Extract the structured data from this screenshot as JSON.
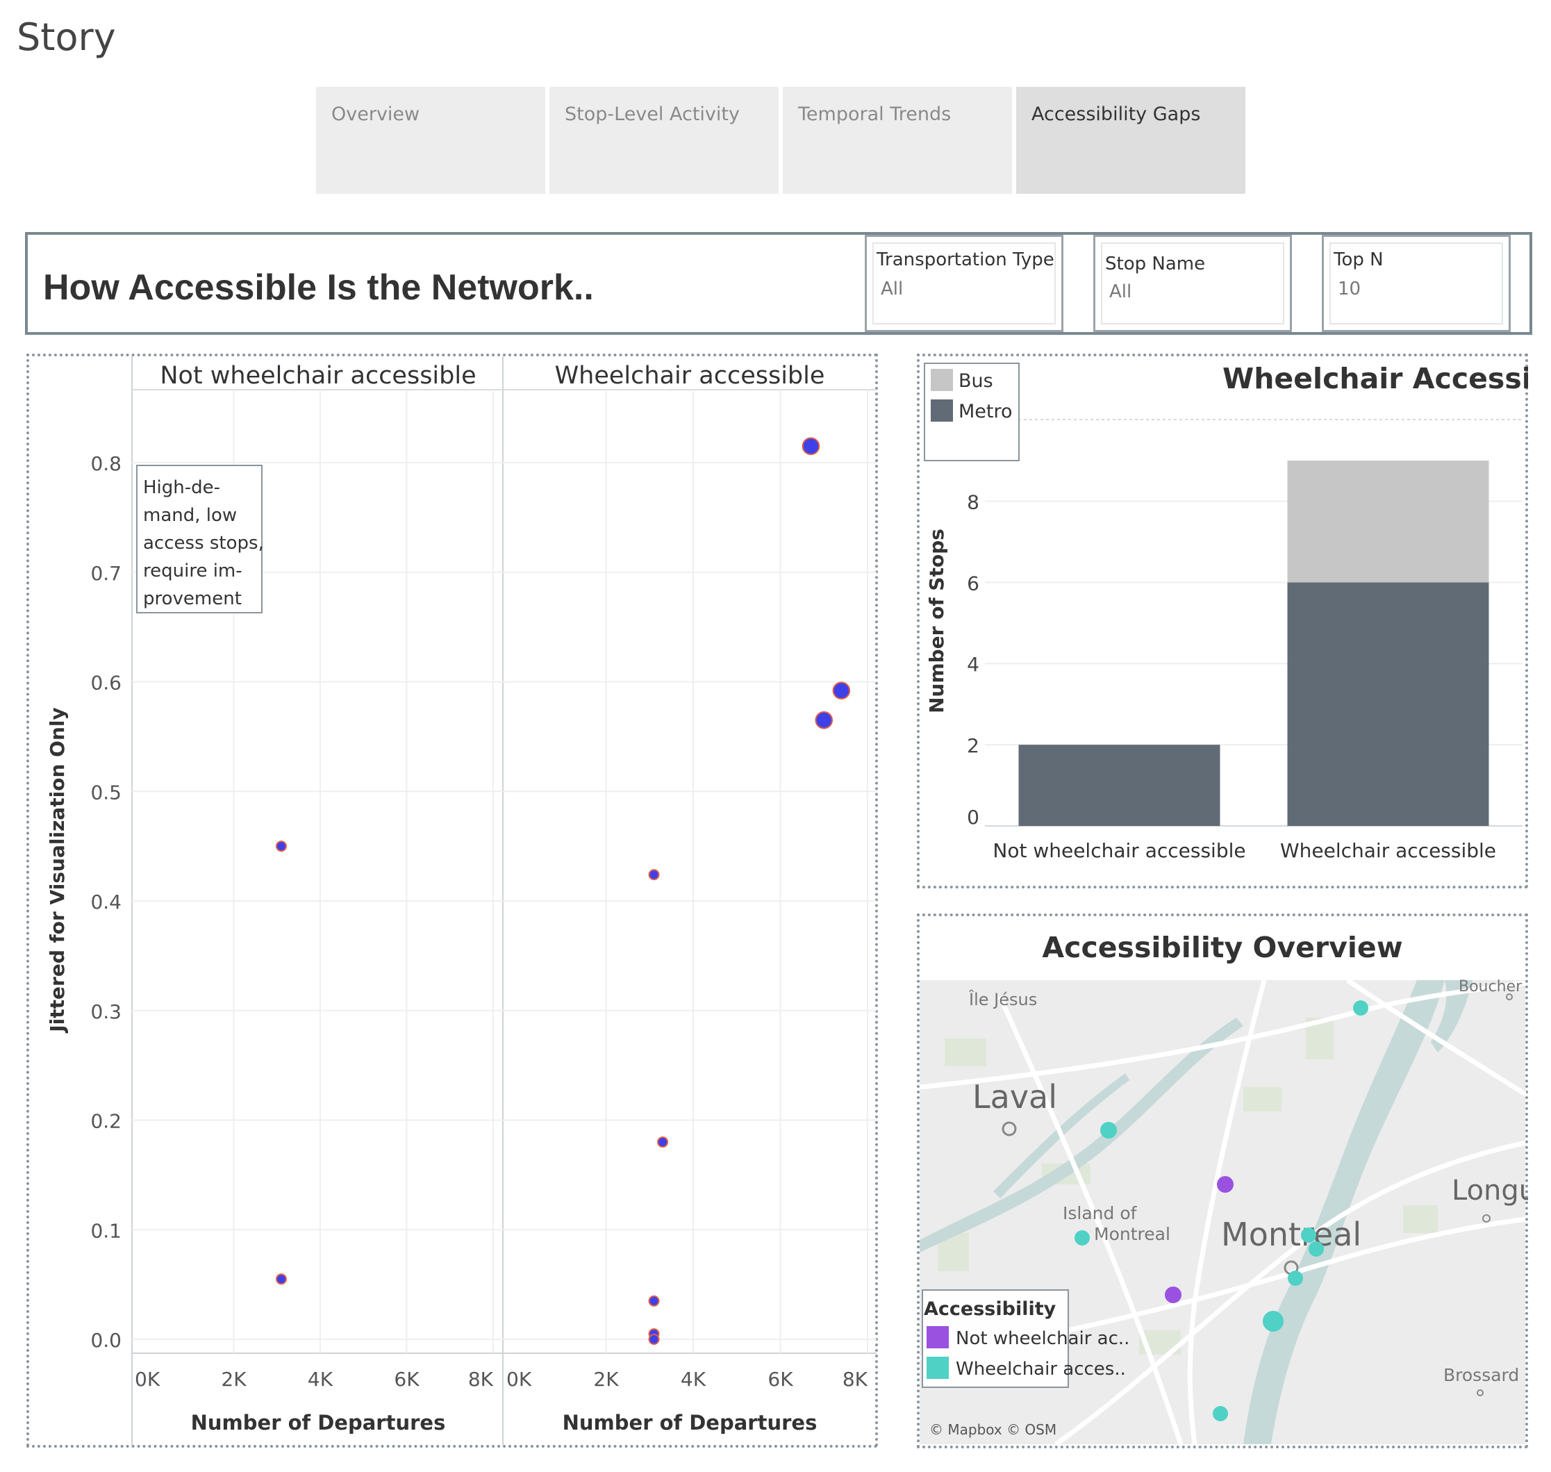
{
  "story": {
    "title": "Story"
  },
  "tabs": [
    {
      "label": "Overview",
      "active": false
    },
    {
      "label": "Stop-Level Activity",
      "active": false
    },
    {
      "label": "Temporal Trends",
      "active": false
    },
    {
      "label": "Accessibility Gaps",
      "active": true
    }
  ],
  "dashboard": {
    "title": "How Accessible Is the Network.."
  },
  "filters": {
    "transport": {
      "label": "Transportation Type",
      "value": "All"
    },
    "stop": {
      "label": "Stop Name",
      "value": "All"
    },
    "topn": {
      "label": "Top N",
      "value": "10"
    }
  },
  "annotation": [
    "High-de-",
    "mand, low",
    "access stops,",
    "require im-",
    "provement"
  ],
  "map": {
    "title": "Accessibility Overview",
    "places": [
      "Île Jésus",
      "Laval",
      "Island of",
      "Montreal",
      "Longue",
      "Boucher",
      "Brossard"
    ],
    "attribution": "© Mapbox © OSM",
    "legend_title": "Accessibility",
    "legend": [
      {
        "label": "Not wheelchair ac..",
        "color": "#9b51e0"
      },
      {
        "label": "Wheelchair acces..",
        "color": "#4fd1c5"
      }
    ],
    "colors": {
      "not_accessible": "#9b51e0",
      "accessible": "#4fd1c5"
    }
  },
  "chart_data": [
    {
      "type": "scatter",
      "title": "",
      "panels": [
        "Not wheelchair accessible",
        "Wheelchair accessible"
      ],
      "xlabel": "Number of Departures",
      "ylabel": "Jittered for Visualization Only",
      "xlim": [
        0,
        8000
      ],
      "ylim": [
        0,
        0.8
      ],
      "x_ticks": [
        "0K",
        "2K",
        "4K",
        "6K",
        "8K"
      ],
      "y_ticks": [
        "0.0",
        "0.1",
        "0.2",
        "0.3",
        "0.4",
        "0.5",
        "0.6",
        "0.7",
        "0.8"
      ],
      "grid": true,
      "marker_color": "#4040e8",
      "marker_edge": "#e0604a",
      "series": [
        {
          "panel": "Not wheelchair accessible",
          "points": [
            {
              "x": 3100,
              "y": 0.45,
              "size": 1
            },
            {
              "x": 3100,
              "y": 0.055,
              "size": 1
            }
          ]
        },
        {
          "panel": "Wheelchair accessible",
          "points": [
            {
              "x": 6700,
              "y": 0.815,
              "size": 1.4
            },
            {
              "x": 7400,
              "y": 0.592,
              "size": 1.4
            },
            {
              "x": 7000,
              "y": 0.565,
              "size": 1.4
            },
            {
              "x": 3100,
              "y": 0.424,
              "size": 1
            },
            {
              "x": 3300,
              "y": 0.18,
              "size": 1
            },
            {
              "x": 3100,
              "y": 0.035,
              "size": 1
            },
            {
              "x": 3100,
              "y": 0.005,
              "size": 1
            },
            {
              "x": 3100,
              "y": 0.0,
              "size": 1
            }
          ]
        }
      ]
    },
    {
      "type": "bar",
      "title": "Wheelchair Accessible Stops",
      "categories": [
        "Not wheelchair accessible",
        "Wheelchair accessible"
      ],
      "xlabel": "",
      "ylabel": "Number of Stops",
      "ylim": [
        0,
        9
      ],
      "y_ticks": [
        "0",
        "2",
        "4",
        "6",
        "8"
      ],
      "stacked": true,
      "legend_position": "top-left",
      "series": [
        {
          "name": "Metro",
          "values": [
            2,
            6
          ],
          "color": "#616b75"
        },
        {
          "name": "Bus",
          "values": [
            0,
            3
          ],
          "color": "#c6c6c6"
        }
      ]
    }
  ]
}
